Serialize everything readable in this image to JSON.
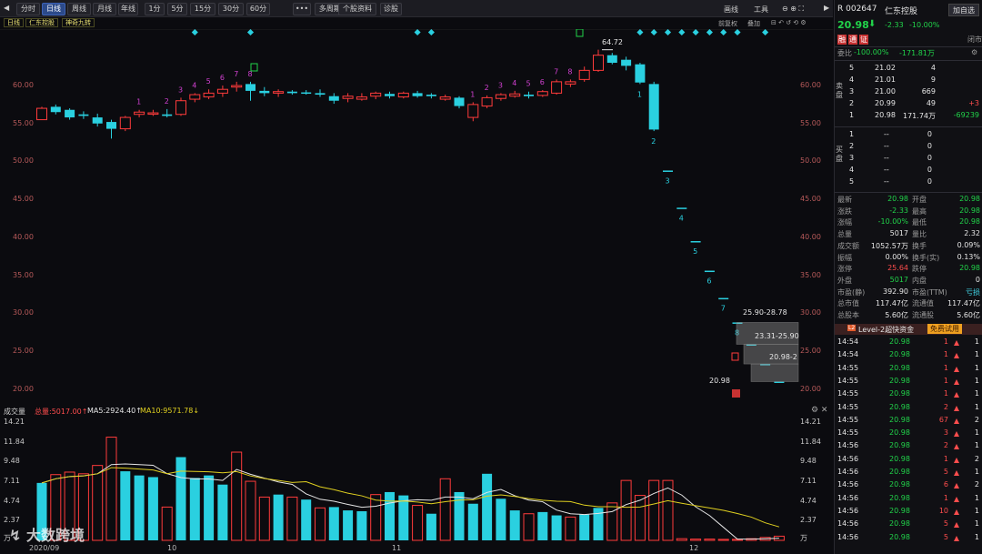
{
  "toolbar": {
    "nav_prev": "◀",
    "nav_next": "▶",
    "periods": [
      "分时",
      "日线",
      "周线",
      "月线",
      "年线",
      "1分",
      "5分",
      "15分",
      "30分",
      "60分"
    ],
    "active_period": "日线",
    "more": "•••",
    "multi_period": "多周期图 ▾",
    "stock_info": "个股资料",
    "diagnose": "诊股",
    "draw": "画线",
    "tools": "工具",
    "prev_adj": "前复权",
    "overlay": "叠加"
  },
  "subbar": {
    "tag_day": "日线",
    "tag_name": "仁东控股",
    "tag_indicator": "神奇九转"
  },
  "main_axis": [
    "60.00",
    "55.00",
    "50.00",
    "45.00",
    "40.00",
    "35.00",
    "30.00",
    "25.00",
    "20.00"
  ],
  "annotations": {
    "high": "64.72",
    "zone1": "25.90-28.78",
    "zone2": "23.31-25.90",
    "zone3": "20.98-2",
    "low": "20.98"
  },
  "volume_bar": {
    "label": "成交量",
    "total": "总量:5017.00↑",
    "ma5": "MA5:2924.40↑",
    "ma10": "MA10:9571.78↓"
  },
  "vol_axis": [
    "14.21",
    "11.84",
    "9.48",
    "7.11",
    "4.74",
    "2.37",
    "万"
  ],
  "dates": [
    "2020/09",
    "10",
    "11",
    "12"
  ],
  "watermark": "大数跨境",
  "chart_data": {
    "type": "candlestick",
    "title": "仁东控股 日线",
    "ylim": [
      19,
      66
    ],
    "categories_note": "daily, 2020/09 – 12",
    "candles": [
      [
        57.0,
        55.5,
        57.2,
        56.0,
        "up"
      ],
      [
        56.5,
        57.2,
        57.5,
        56.2,
        "dn"
      ],
      [
        56.8,
        55.8,
        57.0,
        55.5,
        "dn"
      ],
      [
        56.0,
        56.2,
        56.6,
        55.6,
        "dn"
      ],
      [
        55.8,
        55.0,
        56.3,
        54.6,
        "dn"
      ],
      [
        55.2,
        54.3,
        55.5,
        53.0,
        "dn"
      ],
      [
        54.3,
        55.8,
        56.0,
        54.0,
        "up"
      ],
      [
        56.2,
        56.5,
        56.8,
        55.8,
        "up"
      ],
      [
        56.3,
        56.4,
        56.8,
        56.0,
        "up"
      ],
      [
        56.2,
        56.0,
        56.9,
        55.8,
        "dn"
      ],
      [
        56.2,
        58.0,
        58.4,
        56.0,
        "up"
      ],
      [
        58.2,
        58.8,
        59.0,
        57.8,
        "up"
      ],
      [
        58.5,
        59.0,
        59.5,
        58.2,
        "up"
      ],
      [
        59.0,
        59.5,
        60.0,
        58.5,
        "up"
      ],
      [
        59.8,
        60.0,
        60.5,
        59.2,
        "up"
      ],
      [
        60.2,
        59.3,
        60.5,
        58.0,
        "dn"
      ],
      [
        59.3,
        59.0,
        59.8,
        58.6,
        "dn"
      ],
      [
        59.0,
        59.2,
        59.5,
        58.5,
        "up"
      ],
      [
        59.2,
        59.0,
        59.4,
        58.8,
        "dn"
      ],
      [
        59.0,
        59.1,
        59.4,
        58.8,
        "dn"
      ],
      [
        59.0,
        58.8,
        59.5,
        58.5,
        "dn"
      ],
      [
        58.6,
        58.0,
        59.0,
        57.6,
        "dn"
      ],
      [
        58.3,
        58.6,
        59.0,
        57.8,
        "up"
      ],
      [
        58.2,
        58.5,
        59.0,
        58.0,
        "up"
      ],
      [
        58.6,
        59.0,
        59.2,
        58.2,
        "up"
      ],
      [
        58.9,
        58.6,
        59.2,
        58.3,
        "dn"
      ],
      [
        58.5,
        59.0,
        59.2,
        58.3,
        "up"
      ],
      [
        59.0,
        58.6,
        59.3,
        58.4,
        "dn"
      ],
      [
        58.8,
        58.6,
        59.0,
        58.3,
        "dn"
      ],
      [
        58.2,
        58.5,
        58.8,
        58.0,
        "up"
      ],
      [
        58.4,
        57.3,
        58.6,
        57.0,
        "dn"
      ],
      [
        55.8,
        57.5,
        57.8,
        55.3,
        "up"
      ],
      [
        57.3,
        58.4,
        58.7,
        57.0,
        "up"
      ],
      [
        58.3,
        58.8,
        59.0,
        58.0,
        "up"
      ],
      [
        58.6,
        58.9,
        59.3,
        58.4,
        "up"
      ],
      [
        58.8,
        58.6,
        59.2,
        58.3,
        "dn"
      ],
      [
        58.7,
        59.2,
        59.4,
        58.5,
        "up"
      ],
      [
        59.0,
        60.5,
        60.8,
        58.8,
        "up"
      ],
      [
        60.2,
        60.5,
        60.8,
        59.8,
        "up"
      ],
      [
        60.8,
        62.0,
        62.5,
        60.5,
        "up"
      ],
      [
        62.0,
        64.0,
        64.72,
        61.8,
        "up"
      ],
      [
        64.0,
        63.0,
        64.3,
        62.8,
        "dn"
      ],
      [
        63.4,
        62.6,
        63.8,
        62.0,
        "dn"
      ],
      [
        62.8,
        60.4,
        63.0,
        60.2,
        "dn"
      ],
      [
        60.2,
        54.2,
        60.5,
        54.0,
        "dn"
      ],
      [
        48.8,
        48.8,
        48.8,
        48.8,
        "dn"
      ],
      [
        43.9,
        43.9,
        43.9,
        43.9,
        "dn"
      ],
      [
        39.5,
        39.5,
        39.5,
        39.5,
        "dn"
      ],
      [
        35.6,
        35.6,
        35.6,
        35.6,
        "dn"
      ],
      [
        32.0,
        32.0,
        32.0,
        32.0,
        "dn"
      ],
      [
        28.78,
        28.78,
        28.78,
        28.78,
        "dn"
      ],
      [
        25.9,
        25.9,
        25.9,
        25.9,
        "dn"
      ],
      [
        23.31,
        23.31,
        23.31,
        23.31,
        "dn"
      ],
      [
        20.98,
        20.98,
        20.98,
        20.98,
        "dn"
      ]
    ],
    "volume_ylim": [
      0,
      14.21
    ],
    "volume": [
      [
        6.9,
        "up"
      ],
      [
        7.9,
        "dn"
      ],
      [
        8.2,
        "dn"
      ],
      [
        8.0,
        "dn"
      ],
      [
        9.0,
        "dn"
      ],
      [
        12.4,
        "dn"
      ],
      [
        8.3,
        "up"
      ],
      [
        7.8,
        "up"
      ],
      [
        7.6,
        "up"
      ],
      [
        4.0,
        "dn"
      ],
      [
        10.0,
        "up"
      ],
      [
        7.5,
        "up"
      ],
      [
        7.8,
        "up"
      ],
      [
        6.7,
        "up"
      ],
      [
        10.6,
        "dn"
      ],
      [
        7.1,
        "dn"
      ],
      [
        5.2,
        "dn"
      ],
      [
        5.5,
        "up"
      ],
      [
        5.2,
        "dn"
      ],
      [
        4.9,
        "up"
      ],
      [
        3.9,
        "dn"
      ],
      [
        4.0,
        "up"
      ],
      [
        3.6,
        "up"
      ],
      [
        3.5,
        "up"
      ],
      [
        5.5,
        "dn"
      ],
      [
        5.8,
        "up"
      ],
      [
        5.4,
        "up"
      ],
      [
        4.2,
        "dn"
      ],
      [
        3.2,
        "up"
      ],
      [
        7.4,
        "dn"
      ],
      [
        5.8,
        "up"
      ],
      [
        4.4,
        "up"
      ],
      [
        8.0,
        "up"
      ],
      [
        5.0,
        "up"
      ],
      [
        3.6,
        "up"
      ],
      [
        3.2,
        "dn"
      ],
      [
        3.4,
        "up"
      ],
      [
        3.0,
        "up"
      ],
      [
        2.8,
        "dn"
      ],
      [
        3.1,
        "up"
      ],
      [
        3.9,
        "up"
      ],
      [
        4.5,
        "dn"
      ],
      [
        7.2,
        "dn"
      ],
      [
        5.4,
        "dn"
      ],
      [
        7.2,
        "dn"
      ],
      [
        7.2,
        "dn"
      ],
      [
        0.2,
        "dn"
      ],
      [
        0.15,
        "dn"
      ],
      [
        0.15,
        "dn"
      ],
      [
        0.12,
        "dn"
      ],
      [
        0.12,
        "dn"
      ],
      [
        0.2,
        "dn"
      ],
      [
        0.35,
        "dn"
      ],
      [
        0.5,
        "dn"
      ]
    ],
    "seq_labels": [
      {
        "i": 7,
        "t": "1"
      },
      {
        "i": 9,
        "t": "2"
      },
      {
        "i": 10,
        "t": "3"
      },
      {
        "i": 11,
        "t": "4"
      },
      {
        "i": 12,
        "t": "5"
      },
      {
        "i": 13,
        "t": "6"
      },
      {
        "i": 14,
        "t": "7"
      },
      {
        "i": 15,
        "t": "8"
      },
      {
        "i": 31,
        "t": "1"
      },
      {
        "i": 32,
        "t": "2"
      },
      {
        "i": 33,
        "t": "3"
      },
      {
        "i": 34,
        "t": "4"
      },
      {
        "i": 35,
        "t": "5"
      },
      {
        "i": 36,
        "t": "6"
      },
      {
        "i": 37,
        "t": "7"
      },
      {
        "i": 38,
        "t": "8"
      }
    ],
    "down_seq": [
      {
        "i": 43,
        "t": "1"
      },
      {
        "i": 44,
        "t": "2"
      },
      {
        "i": 45,
        "t": "3"
      },
      {
        "i": 46,
        "t": "4"
      },
      {
        "i": 47,
        "t": "5"
      },
      {
        "i": 48,
        "t": "6"
      },
      {
        "i": 49,
        "t": "7"
      },
      {
        "i": 50,
        "t": "8"
      }
    ],
    "colors": {
      "up": "#ff3b3b",
      "down": "#2ad0e0",
      "ma5": "#e6e6e6",
      "ma10": "#e0d020"
    }
  },
  "panel": {
    "header": {
      "code": "R 002647",
      "name": "仁东控股",
      "add_watch": "加自选",
      "price": "20.98",
      "change": "-2.33",
      "change_pct": "-10.00%",
      "badges": [
        "融",
        "通",
        "证"
      ],
      "close_status": "闭市",
      "wei_bi_label": "委比",
      "wei_bi": "-100.00%",
      "wei_cha": "-171.81万"
    },
    "sell": [
      {
        "n": "5",
        "p": "21.02",
        "v": "4",
        "d": ""
      },
      {
        "n": "4",
        "p": "21.01",
        "v": "9",
        "d": ""
      },
      {
        "n": "3",
        "p": "21.00",
        "v": "669",
        "d": ""
      },
      {
        "n": "2",
        "p": "20.99",
        "v": "49",
        "d": "+3"
      },
      {
        "n": "1",
        "p": "20.98",
        "v": "171.74万",
        "d": "-69239"
      }
    ],
    "sell_label": "卖盘",
    "buy": [
      {
        "n": "1",
        "p": "--",
        "v": "0"
      },
      {
        "n": "2",
        "p": "--",
        "v": "0"
      },
      {
        "n": "3",
        "p": "--",
        "v": "0"
      },
      {
        "n": "4",
        "p": "--",
        "v": "0"
      },
      {
        "n": "5",
        "p": "--",
        "v": "0"
      }
    ],
    "buy_label": "买盘",
    "quote": [
      [
        "最新",
        "20.98",
        "开盘",
        "20.98"
      ],
      [
        "涨跌",
        "-2.33",
        "最高",
        "20.98"
      ],
      [
        "涨幅",
        "-10.00%",
        "最低",
        "20.98"
      ],
      [
        "总量",
        "5017",
        "量比",
        "2.32"
      ],
      [
        "成交额",
        "1052.57万",
        "换手",
        "0.09%"
      ],
      [
        "振幅",
        "0.00%",
        "换手(实)",
        "0.13%"
      ],
      [
        "涨停",
        "25.64",
        "跌停",
        "20.98"
      ],
      [
        "外盘",
        "5017",
        "内盘",
        "0"
      ],
      [
        "市盈(静)",
        "392.90",
        "市盈(TTM)",
        "亏损"
      ],
      [
        "总市值",
        "117.47亿",
        "流通值",
        "117.47亿"
      ],
      [
        "总股本",
        "5.60亿",
        "流通股",
        "5.60亿"
      ]
    ],
    "level2": {
      "badge": "L2",
      "text": "Level-2超快资金",
      "trial": "免费试用"
    },
    "trades": [
      [
        "14:54",
        "20.98",
        "1",
        "1"
      ],
      [
        "14:54",
        "20.98",
        "1",
        "1"
      ],
      [
        "14:55",
        "20.98",
        "1",
        "1"
      ],
      [
        "14:55",
        "20.98",
        "1",
        "1"
      ],
      [
        "14:55",
        "20.98",
        "1",
        "1"
      ],
      [
        "14:55",
        "20.98",
        "2",
        "1"
      ],
      [
        "14:55",
        "20.98",
        "67",
        "2"
      ],
      [
        "14:55",
        "20.98",
        "3",
        "1"
      ],
      [
        "14:56",
        "20.98",
        "2",
        "1"
      ],
      [
        "14:56",
        "20.98",
        "1",
        "2"
      ],
      [
        "14:56",
        "20.98",
        "5",
        "1"
      ],
      [
        "14:56",
        "20.98",
        "6",
        "2"
      ],
      [
        "14:56",
        "20.98",
        "1",
        "1"
      ],
      [
        "14:56",
        "20.98",
        "10",
        "1"
      ],
      [
        "14:56",
        "20.98",
        "5",
        "1"
      ],
      [
        "14:56",
        "20.98",
        "5",
        "1"
      ]
    ]
  }
}
